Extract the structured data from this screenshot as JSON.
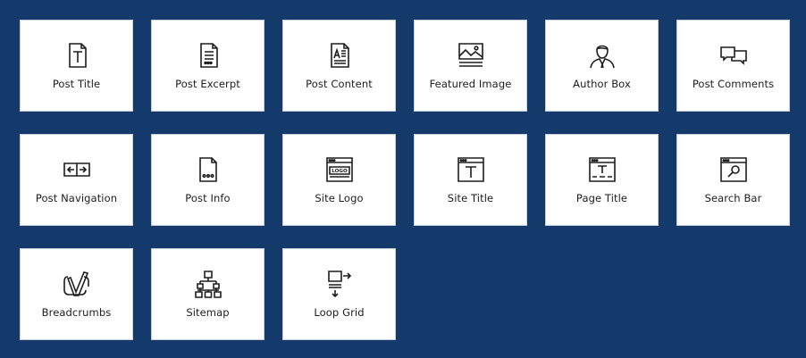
{
  "widgets": [
    {
      "label": "Post Title",
      "icon": "post-title-icon"
    },
    {
      "label": "Post Excerpt",
      "icon": "post-excerpt-icon"
    },
    {
      "label": "Post Content",
      "icon": "post-content-icon"
    },
    {
      "label": "Featured Image",
      "icon": "featured-image-icon"
    },
    {
      "label": "Author Box",
      "icon": "author-box-icon"
    },
    {
      "label": "Post Comments",
      "icon": "post-comments-icon"
    },
    {
      "label": "Post Navigation",
      "icon": "post-navigation-icon"
    },
    {
      "label": "Post Info",
      "icon": "post-info-icon"
    },
    {
      "label": "Site Logo",
      "icon": "site-logo-icon"
    },
    {
      "label": "Site Title",
      "icon": "site-title-icon"
    },
    {
      "label": "Page Title",
      "icon": "page-title-icon"
    },
    {
      "label": "Search Bar",
      "icon": "search-bar-icon"
    },
    {
      "label": "Breadcrumbs",
      "icon": "breadcrumbs-icon"
    },
    {
      "label": "Sitemap",
      "icon": "sitemap-icon"
    },
    {
      "label": "Loop Grid",
      "icon": "loop-grid-icon"
    }
  ],
  "colors": {
    "background": "#133a6a",
    "tile": "#ffffff",
    "text": "#1d1d1f",
    "icon": "#1d1d1f"
  },
  "logo_text": "LOGO"
}
